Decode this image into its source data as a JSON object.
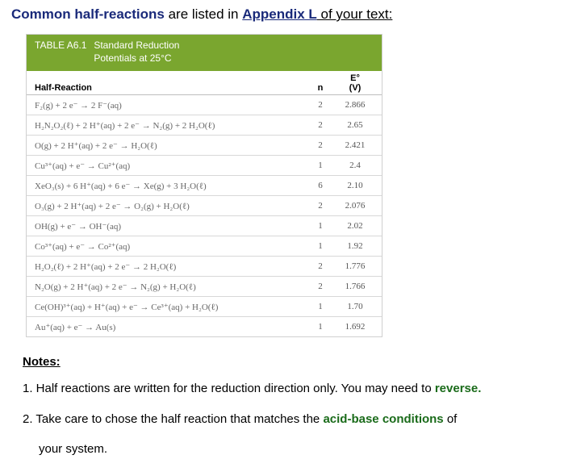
{
  "headline": {
    "part1": "Common half-reactions",
    "part2": " are listed in ",
    "part3": "Appendix L",
    "part4": " of your text:"
  },
  "table": {
    "label": "TABLE A6.1",
    "title_l1": "Standard Reduction",
    "title_l2": "Potentials at 25°C",
    "head_reaction": "Half-Reaction",
    "head_n": "n",
    "head_e_top": "E°",
    "head_e_bot": "(V)",
    "rows": [
      {
        "rxn": "F₂(g) + 2 e⁻ → 2 F⁻(aq)",
        "n": "2",
        "e": "2.866"
      },
      {
        "rxn": "H₂N₂O₂(ℓ) + 2 H⁺(aq) + 2 e⁻ → N₂(g) + 2 H₂O(ℓ)",
        "n": "2",
        "e": "2.65"
      },
      {
        "rxn": "O(g) + 2 H⁺(aq) + 2 e⁻ → H₂O(ℓ)",
        "n": "2",
        "e": "2.421"
      },
      {
        "rxn": "Cu³⁺(aq) + e⁻ → Cu²⁺(aq)",
        "n": "1",
        "e": "2.4"
      },
      {
        "rxn": "XeO₃(s) + 6 H⁺(aq) + 6 e⁻ → Xe(g) + 3 H₂O(ℓ)",
        "n": "6",
        "e": "2.10"
      },
      {
        "rxn": "O₃(g) + 2 H⁺(aq) + 2 e⁻ → O₂(g) + H₂O(ℓ)",
        "n": "2",
        "e": "2.076"
      },
      {
        "rxn": "OH(g) + e⁻ → OH⁻(aq)",
        "n": "1",
        "e": "2.02"
      },
      {
        "rxn": "Co³⁺(aq) + e⁻ → Co²⁺(aq)",
        "n": "1",
        "e": "1.92"
      },
      {
        "rxn": "H₂O₂(ℓ) + 2 H⁺(aq) + 2 e⁻ → 2 H₂O(ℓ)",
        "n": "2",
        "e": "1.776"
      },
      {
        "rxn": "N₂O(g) + 2 H⁺(aq) + 2 e⁻ → N₂(g) + H₂O(ℓ)",
        "n": "2",
        "e": "1.766"
      },
      {
        "rxn": "Ce(OH)³⁺(aq) + H⁺(aq) + e⁻ → Ce³⁺(aq) + H₂O(ℓ)",
        "n": "1",
        "e": "1.70"
      },
      {
        "rxn": "Au⁺(aq) + e⁻ → Au(s)",
        "n": "1",
        "e": "1.692"
      }
    ]
  },
  "notes": {
    "heading": "Notes:",
    "n1a": "1. Half reactions are written for the reduction direction only. You may need to ",
    "n1b": "reverse.",
    "n2a": "2. Take care to chose the half reaction that matches the ",
    "n2b": "acid-base conditions",
    "n2c": " of",
    "n2d": "your system."
  }
}
